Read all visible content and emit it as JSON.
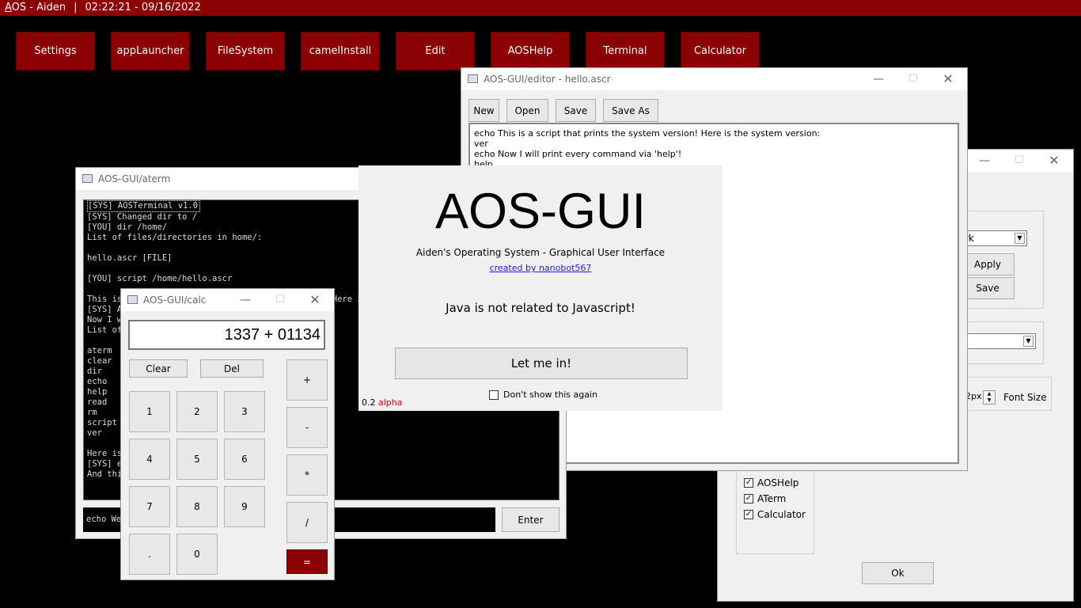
{
  "topbar": {
    "title_initial": "A",
    "title_rest": "OS - Aiden",
    "separator": "|",
    "datetime": "02:22:21 - 09/16/2022"
  },
  "apps": [
    "Settings",
    "appLauncher",
    "FileSystem",
    "camelInstall",
    "Edit",
    "AOSHelp",
    "Terminal",
    "Calculator"
  ],
  "colors": {
    "accent": "#8b0000",
    "background": "#000000",
    "link": "#2222cc",
    "alpha_tag": "#dd0000"
  },
  "settings": {
    "combo1_value": "rk",
    "apply_label": "Apply",
    "save_label": "Save",
    "combo2_value": "",
    "font_size_value": "2px",
    "font_size_label": "Font Size",
    "checkboxes": [
      {
        "label": "AOSHelp",
        "checked": true
      },
      {
        "label": "ATerm",
        "checked": true
      },
      {
        "label": "Calculator",
        "checked": true
      }
    ],
    "ok_label": "Ok"
  },
  "editor": {
    "title": "AOS-GUI/editor - hello.ascr",
    "toolbar": {
      "new": "New",
      "open": "Open",
      "save": "Save",
      "save_as": "Save As"
    },
    "content": "echo This is a script that prints the system version! Here is the system version:\nver\necho Now I will print every command via 'help'!\nhelp"
  },
  "aterm": {
    "title": "AOS-GUI/aterm",
    "first_line": "[SYS] AOSTerminal v1.0",
    "lines": [
      "[SYS] Changed dir to /",
      "[YOU] dir /home/",
      "List of files/directories in home/:",
      "",
      "hello.ascr [FILE]",
      "",
      "[YOU] script /home/hello.ascr",
      "",
      "This is a script that prints the system version! Here is the system version:",
      "[SYS] AOSTerminal v1.0",
      "Now I will print every command via 'help'!",
      "List of commands:",
      "",
      "aterm",
      "clear",
      "dir",
      "echo",
      "help",
      "read",
      "rm",
      "script",
      "ver",
      "",
      "Here is the end of the script.",
      "[SYS] echo is done",
      "And this is the end."
    ],
    "input_value": "echo Welcome to AOS-GUI!",
    "enter_label": "Enter"
  },
  "calc": {
    "title": "AOS-GUI/calc",
    "display": "1337 + 01134",
    "clear_label": "Clear",
    "del_label": "Del",
    "digits": [
      "1",
      "2",
      "3",
      "4",
      "5",
      "6",
      "7",
      "8",
      "9",
      ".",
      "0"
    ],
    "ops": [
      "+",
      "-",
      "*",
      "/",
      "="
    ]
  },
  "splash": {
    "heading": "AOS-GUI",
    "subtitle": "Aiden's Operating System - Graphical User Interface",
    "credit": "created by nanobot567",
    "fact": "Java is not related to Javascript!",
    "button": "Let me in!",
    "dont_show": "Don't show this again",
    "version": "0.2",
    "version_tag": "alpha"
  }
}
